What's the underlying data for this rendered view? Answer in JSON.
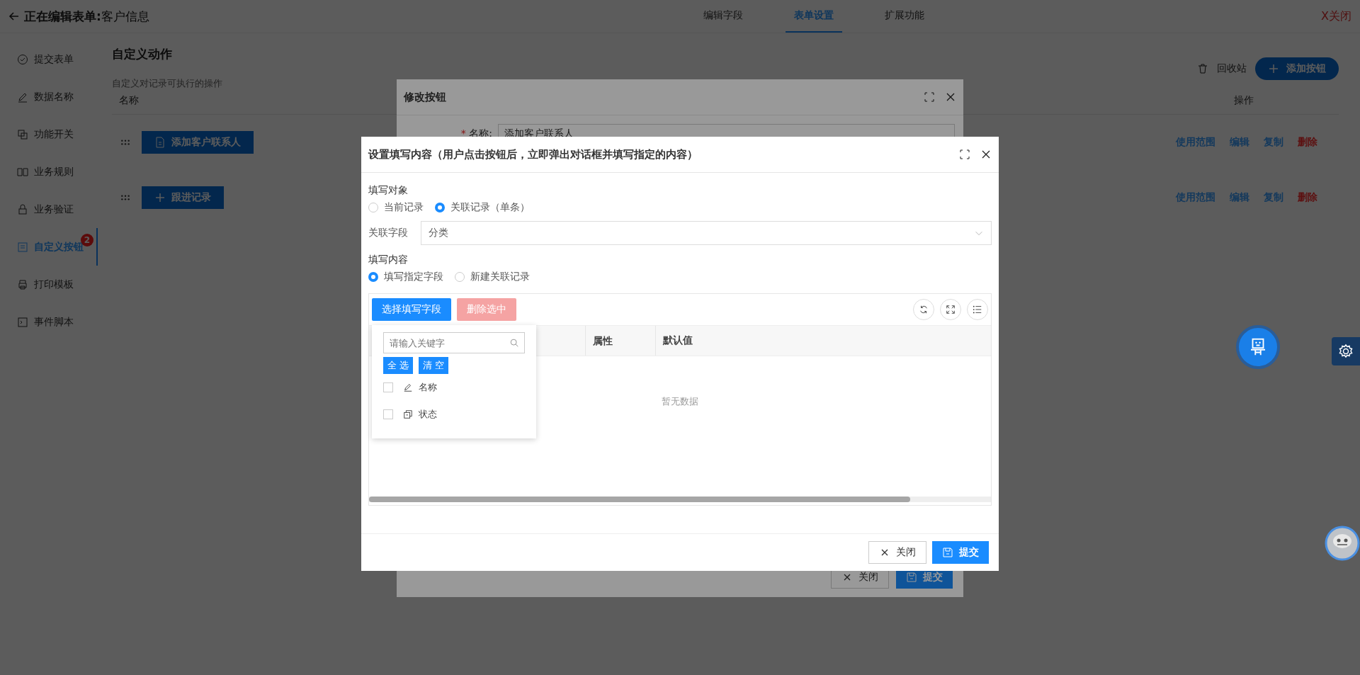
{
  "header": {
    "title": "**正在编辑表单:**客户信息",
    "tabs": [
      {
        "label": "编辑字段",
        "selected": false
      },
      {
        "label": "表单设置",
        "selected": true
      },
      {
        "label": "扩展功能",
        "selected": false
      }
    ],
    "close": "X关闭"
  },
  "sidebar": {
    "items": [
      {
        "label": "提交表单",
        "selected": false
      },
      {
        "label": "数据名称",
        "selected": false
      },
      {
        "label": "功能开关",
        "selected": false
      },
      {
        "label": "业务规则",
        "selected": false
      },
      {
        "label": "业务验证",
        "selected": false
      },
      {
        "label": "自定义按钮",
        "selected": true,
        "badge": "2"
      },
      {
        "label": "打印模板",
        "selected": false
      },
      {
        "label": "事件脚本",
        "selected": false
      }
    ]
  },
  "content": {
    "title": "自定义动作",
    "description": "自定义对记录可执行的操作",
    "recycle": "回收站",
    "add_button": "添加按钮",
    "columns": [
      "名称",
      "操作"
    ],
    "rows": [
      {
        "name": "添加客户联系人",
        "kind": "document",
        "actions": [
          {
            "label": "使用范围",
            "kind": "link"
          },
          {
            "label": "编辑",
            "kind": "link"
          },
          {
            "label": "复制",
            "kind": "link"
          },
          {
            "label": "删除",
            "kind": "danger"
          }
        ]
      },
      {
        "name": "跟进记录",
        "kind": "plus",
        "actions": [
          {
            "label": "使用范围",
            "kind": "link"
          },
          {
            "label": "编辑",
            "kind": "link"
          },
          {
            "label": "复制",
            "kind": "link"
          },
          {
            "label": "删除",
            "kind": "danger"
          }
        ]
      }
    ]
  },
  "edit_dialog": {
    "title": "修改按钮",
    "field_label": "名称:",
    "required_mark": "*",
    "field_value": "添加客户联系人",
    "buttons": [
      {
        "label": "关闭",
        "kind": "default"
      },
      {
        "label": "提交",
        "kind": "primary"
      }
    ]
  },
  "fill_dialog": {
    "title": "设置填写内容（用户点击按钮后，立即弹出对话框并填写指定的内容）",
    "target_label": "填写对象",
    "target_options": [
      {
        "label": "当前记录",
        "selected": false
      },
      {
        "label": "关联记录（单条）",
        "selected": true
      }
    ],
    "relation_label": "关联字段",
    "relation_value": "分类",
    "content_label": "填写内容",
    "content_options": [
      {
        "label": "填写指定字段",
        "selected": true
      },
      {
        "label": "新建关联记录",
        "selected": false
      }
    ],
    "select_button": "选择填写字段",
    "delete_button": "删除选中",
    "delete_disabled": true,
    "columns": [
      "属性",
      "默认值"
    ],
    "empty": "暂无数据",
    "picker": {
      "placeholder": "请输入关键字",
      "select_all": "全 选",
      "clear": "清 空",
      "fields": [
        {
          "label": "名称",
          "kind": "text",
          "checked": false
        },
        {
          "label": "状态",
          "kind": "status",
          "checked": false
        }
      ]
    },
    "buttons": [
      {
        "label": "关闭",
        "kind": "default"
      },
      {
        "label": "提交",
        "kind": "primary"
      }
    ]
  }
}
